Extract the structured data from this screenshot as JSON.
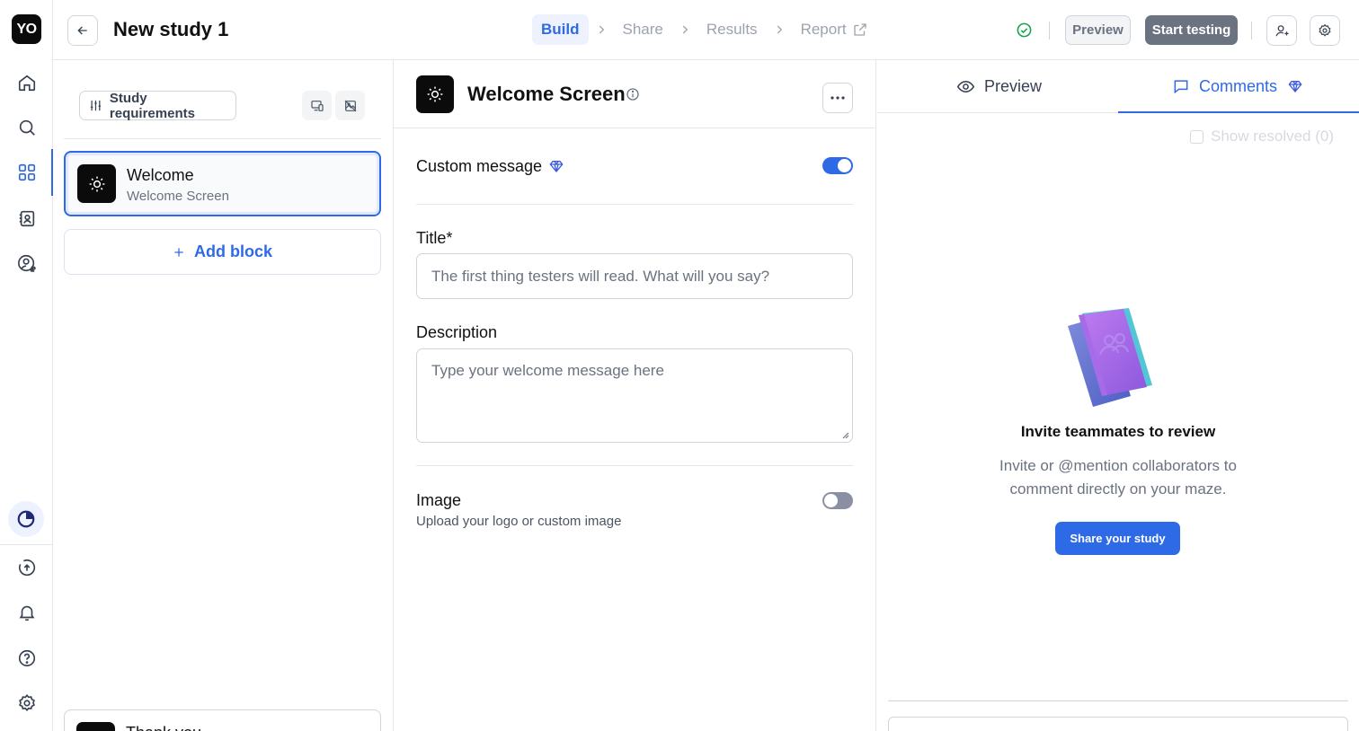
{
  "rail": {
    "logo_text": "YO",
    "items": [
      "home",
      "search",
      "studies",
      "contacts",
      "panel"
    ],
    "bottom_items": [
      "upgrade",
      "notifications",
      "help",
      "settings"
    ]
  },
  "header": {
    "study_title": "New study 1",
    "steps": [
      {
        "label": "Build",
        "state": "active"
      },
      {
        "label": "Share",
        "state": "disabled"
      },
      {
        "label": "Results",
        "state": "disabled"
      },
      {
        "label": "Report",
        "state": "disabled"
      }
    ],
    "preview_label": "Preview",
    "start_label": "Start testing"
  },
  "blocks_panel": {
    "requirements_label": "Study requirements",
    "blocks": [
      {
        "title": "Welcome",
        "subtitle": "Welcome Screen",
        "selected": true
      }
    ],
    "add_block_label": "Add block",
    "footer_block_title": "Thank you"
  },
  "editor": {
    "title": "Welcome Screen",
    "custom_message_label": "Custom message",
    "custom_message_enabled": true,
    "title_label": "Title*",
    "title_placeholder": "The first thing testers will read. What will you say?",
    "description_label": "Description",
    "description_placeholder": "Type your welcome message here",
    "image_label": "Image",
    "image_sublabel": "Upload your logo or custom image",
    "image_enabled": false
  },
  "right_panel": {
    "tabs": [
      {
        "label": "Preview",
        "active": false
      },
      {
        "label": "Comments",
        "active": true
      }
    ],
    "show_resolved_label": "Show resolved (0)",
    "invite_title": "Invite teammates to review",
    "invite_text": "Invite or @mention collaborators to comment directly on your maze.",
    "share_button_label": "Share your study"
  },
  "colors": {
    "accent": "#2f6ae6",
    "success": "#16a34a",
    "dark": "#0b0b0b"
  }
}
